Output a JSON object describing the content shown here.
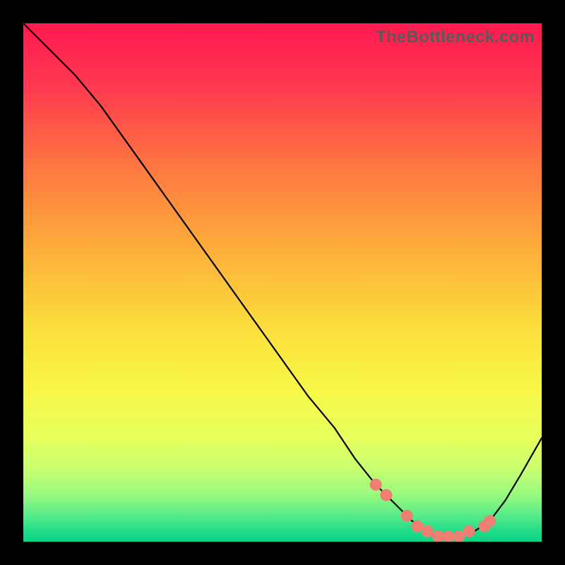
{
  "watermark": "TheBottleneck.com",
  "chart_data": {
    "type": "line",
    "title": "",
    "xlabel": "",
    "ylabel": "",
    "xlim": [
      0,
      100
    ],
    "ylim": [
      0,
      100
    ],
    "grid": false,
    "series": [
      {
        "name": "bottleneck-curve",
        "x": [
          0,
          3,
          6,
          10,
          15,
          20,
          25,
          30,
          35,
          40,
          45,
          50,
          55,
          60,
          64,
          68,
          72,
          75,
          78,
          81,
          84,
          87,
          90,
          93,
          96,
          100
        ],
        "y": [
          100,
          97,
          94,
          90,
          84,
          77,
          70,
          63,
          56,
          49,
          42,
          35,
          28,
          22,
          16,
          11,
          7,
          4,
          2,
          1,
          1,
          2,
          4,
          8,
          13,
          20
        ]
      }
    ],
    "markers": {
      "name": "highlight-dots",
      "x": [
        68,
        70,
        74,
        76,
        78,
        80,
        82,
        84,
        86,
        89,
        90
      ],
      "y": [
        11,
        9,
        5,
        3,
        2,
        1,
        1,
        1,
        2,
        3,
        4
      ]
    },
    "gradient_stops": [
      {
        "offset": 0.0,
        "color": "#ff1a4f"
      },
      {
        "offset": 0.12,
        "color": "#ff3850"
      },
      {
        "offset": 0.28,
        "color": "#fd7840"
      },
      {
        "offset": 0.45,
        "color": "#fcb23a"
      },
      {
        "offset": 0.6,
        "color": "#fbe23d"
      },
      {
        "offset": 0.72,
        "color": "#f7f94a"
      },
      {
        "offset": 0.8,
        "color": "#e6ff5d"
      },
      {
        "offset": 0.86,
        "color": "#c7ff70"
      },
      {
        "offset": 0.91,
        "color": "#98f97f"
      },
      {
        "offset": 0.955,
        "color": "#4de98a"
      },
      {
        "offset": 0.98,
        "color": "#1fdc8a"
      },
      {
        "offset": 1.0,
        "color": "#0cd184"
      }
    ]
  }
}
